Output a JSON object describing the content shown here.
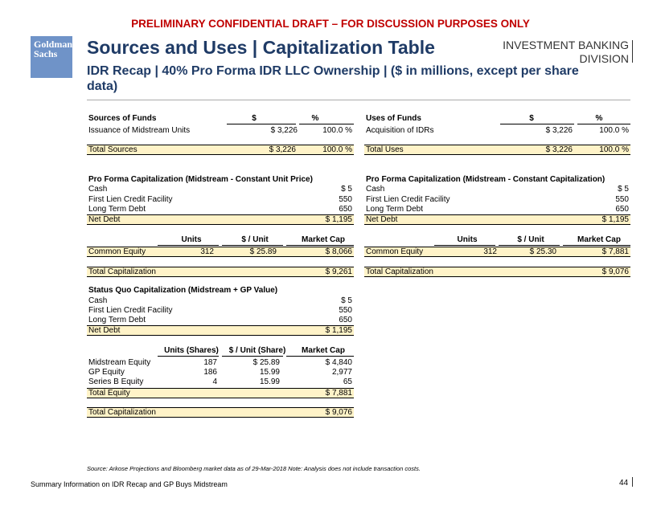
{
  "banner": "PRELIMINARY CONFIDENTIAL DRAFT – FOR DISCUSSION PURPOSES ONLY",
  "logo": {
    "line1": "Goldman",
    "line2": "Sachs"
  },
  "title": "Sources and Uses | Capitalization Table",
  "subtitle": "IDR Recap | 40% Pro Forma IDR LLC Ownership | ($ in millions, except per share data)",
  "division": {
    "line1": "INVESTMENT BANKING",
    "line2": "DIVISION"
  },
  "sources": {
    "header": [
      "Sources of Funds",
      "$",
      "%"
    ],
    "row": [
      "Issuance of Midstream Units",
      "$ 3,226",
      "100.0 %"
    ],
    "total": [
      "Total Sources",
      "$ 3,226",
      "100.0 %"
    ]
  },
  "uses": {
    "header": [
      "Uses of Funds",
      "$",
      "%"
    ],
    "row": [
      "Acquisition of IDRs",
      "$ 3,226",
      "100.0 %"
    ],
    "total": [
      "Total Uses",
      "$ 3,226",
      "100.0 %"
    ]
  },
  "pf_left": {
    "title": "Pro Forma Capitalization (Midstream - Constant Unit Price)",
    "rows": [
      [
        "Cash",
        "$ 5"
      ],
      [
        "First Lien Credit Facility",
        "550"
      ],
      [
        "Long Term Debt",
        "650"
      ]
    ],
    "net_debt": [
      "Net Debt",
      "$ 1,195"
    ],
    "eq_header": [
      "Units",
      "$ / Unit",
      "Market Cap"
    ],
    "equity": [
      "Common Equity",
      "312",
      "$ 25.89",
      "$ 8,066"
    ],
    "total": [
      "Total Capitalization",
      "$ 9,261"
    ]
  },
  "pf_right": {
    "title": "Pro Forma Capitalization (Midstream - Constant Capitalization)",
    "rows": [
      [
        "Cash",
        "$ 5"
      ],
      [
        "First Lien Credit Facility",
        "550"
      ],
      [
        "Long Term Debt",
        "650"
      ]
    ],
    "net_debt": [
      "Net Debt",
      "$ 1,195"
    ],
    "eq_header": [
      "Units",
      "$ / Unit",
      "Market Cap"
    ],
    "equity": [
      "Common Equity",
      "312",
      "$ 25.30",
      "$ 7,881"
    ],
    "total": [
      "Total Capitalization",
      "$ 9,076"
    ]
  },
  "sq": {
    "title": "Status Quo Capitalization (Midstream + GP Value)",
    "rows": [
      [
        "Cash",
        "$ 5"
      ],
      [
        "First Lien Credit Facility",
        "550"
      ],
      [
        "Long Term Debt",
        "650"
      ]
    ],
    "net_debt": [
      "Net Debt",
      "$ 1,195"
    ],
    "eq_header": [
      "Units (Shares)",
      "$ / Unit (Share)",
      "Market Cap"
    ],
    "equity_rows": [
      [
        "Midstream Equity",
        "187",
        "$ 25.89",
        "$ 4,840"
      ],
      [
        "GP Equity",
        "186",
        "15.99",
        "2,977"
      ],
      [
        "Series B Equity",
        "4",
        "15.99",
        "65"
      ]
    ],
    "total_equity": [
      "Total Equity",
      "$ 7,881"
    ],
    "total": [
      "Total Capitalization",
      "$ 9,076"
    ]
  },
  "source_note": "Source: Arkose Projections and Bloomberg market data as of 29-Mar-2018  Note: Analysis does not include transaction costs.",
  "footer": "Summary Information on IDR Recap and GP Buys Midstream",
  "page_number": "44"
}
